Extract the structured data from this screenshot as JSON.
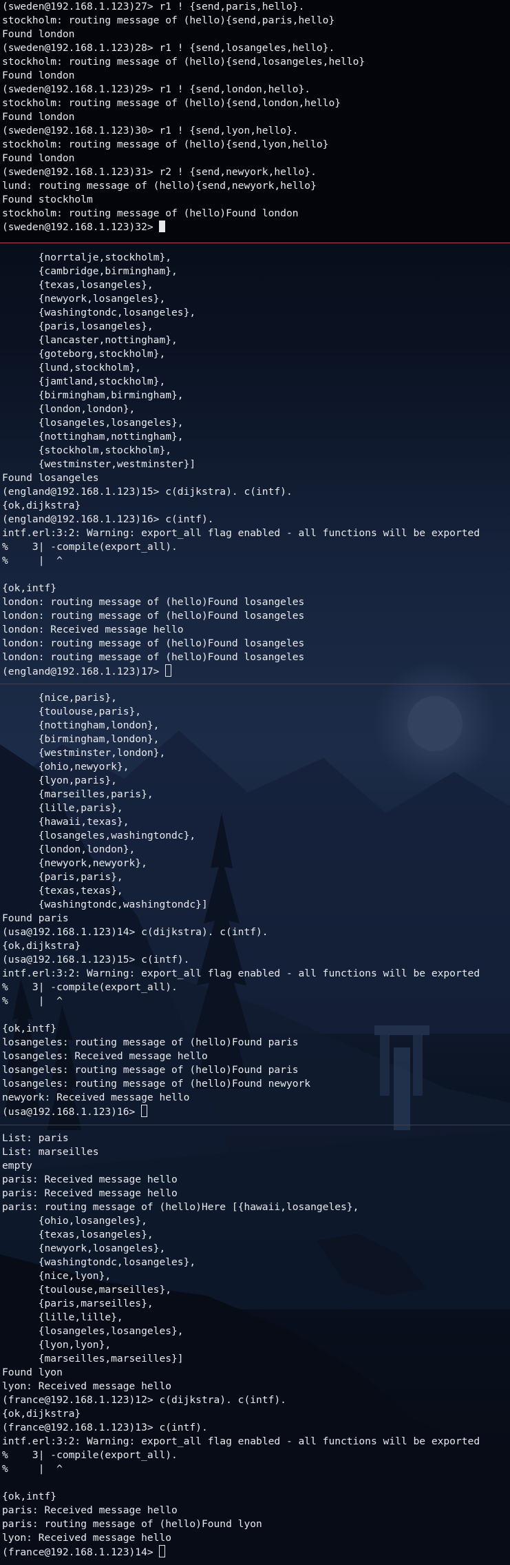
{
  "colors": {
    "background": "#0b1424",
    "text": "#e8eaee",
    "active_divider": "#b23a48",
    "inactive_divider": "#3b4253"
  },
  "panes": [
    {
      "node": "sweden",
      "lines": [
        "(sweden@192.168.1.123)27> r1 ! {send,paris,hello}.",
        "stockholm: routing message of (hello){send,paris,hello}",
        "Found london",
        "(sweden@192.168.1.123)28> r1 ! {send,losangeles,hello}.",
        "stockholm: routing message of (hello){send,losangeles,hello}",
        "Found london",
        "(sweden@192.168.1.123)29> r1 ! {send,london,hello}.",
        "stockholm: routing message of (hello){send,london,hello}",
        "Found london",
        "(sweden@192.168.1.123)30> r1 ! {send,lyon,hello}.",
        "stockholm: routing message of (hello){send,lyon,hello}",
        "Found london",
        "(sweden@192.168.1.123)31> r2 ! {send,newyork,hello}.",
        "lund: routing message of (hello){send,newyork,hello}",
        "Found stockholm",
        "stockholm: routing message of (hello)Found london"
      ],
      "prompt": "(sweden@192.168.1.123)32> "
    },
    {
      "node": "england",
      "lines": [
        "      {norrtalje,stockholm},",
        "      {cambridge,birmingham},",
        "      {texas,losangeles},",
        "      {newyork,losangeles},",
        "      {washingtondc,losangeles},",
        "      {paris,losangeles},",
        "      {lancaster,nottingham},",
        "      {goteborg,stockholm},",
        "      {lund,stockholm},",
        "      {jamtland,stockholm},",
        "      {birmingham,birmingham},",
        "      {london,london},",
        "      {losangeles,losangeles},",
        "      {nottingham,nottingham},",
        "      {stockholm,stockholm},",
        "      {westminster,westminster}]",
        "Found losangeles",
        "(england@192.168.1.123)15> c(dijkstra). c(intf).",
        "{ok,dijkstra}",
        "(england@192.168.1.123)16> c(intf).",
        "intf.erl:3:2: Warning: export_all flag enabled - all functions will be exported",
        "%    3| -compile(export_all).",
        "%     |  ^",
        "",
        "{ok,intf}",
        "london: routing message of (hello)Found losangeles",
        "london: routing message of (hello)Found losangeles",
        "london: Received message hello",
        "london: routing message of (hello)Found losangeles",
        "london: routing message of (hello)Found losangeles"
      ],
      "prompt": "(england@192.168.1.123)17> "
    },
    {
      "node": "usa",
      "lines": [
        "      {nice,paris},",
        "      {toulouse,paris},",
        "      {nottingham,london},",
        "      {birmingham,london},",
        "      {westminster,london},",
        "      {ohio,newyork},",
        "      {lyon,paris},",
        "      {marseilles,paris},",
        "      {lille,paris},",
        "      {hawaii,texas},",
        "      {losangeles,washingtondc},",
        "      {london,london},",
        "      {newyork,newyork},",
        "      {paris,paris},",
        "      {texas,texas},",
        "      {washingtondc,washingtondc}]",
        "Found paris",
        "(usa@192.168.1.123)14> c(dijkstra). c(intf).",
        "{ok,dijkstra}",
        "(usa@192.168.1.123)15> c(intf).",
        "intf.erl:3:2: Warning: export_all flag enabled - all functions will be exported",
        "%    3| -compile(export_all).",
        "%     |  ^",
        "",
        "{ok,intf}",
        "losangeles: routing message of (hello)Found paris",
        "losangeles: Received message hello",
        "losangeles: routing message of (hello)Found paris",
        "losangeles: routing message of (hello)Found newyork",
        "newyork: Received message hello"
      ],
      "prompt": "(usa@192.168.1.123)16> "
    },
    {
      "node": "france",
      "lines": [
        "List: paris",
        "List: marseilles",
        "empty",
        "paris: Received message hello",
        "paris: Received message hello",
        "paris: routing message of (hello)Here [{hawaii,losangeles},",
        "      {ohio,losangeles},",
        "      {texas,losangeles},",
        "      {newyork,losangeles},",
        "      {washingtondc,losangeles},",
        "      {nice,lyon},",
        "      {toulouse,marseilles},",
        "      {paris,marseilles},",
        "      {lille,lille},",
        "      {losangeles,losangeles},",
        "      {lyon,lyon},",
        "      {marseilles,marseilles}]",
        "Found lyon",
        "lyon: Received message hello",
        "(france@192.168.1.123)12> c(dijkstra). c(intf).",
        "{ok,dijkstra}",
        "(france@192.168.1.123)13> c(intf).",
        "intf.erl:3:2: Warning: export_all flag enabled - all functions will be exported",
        "%    3| -compile(export_all).",
        "%     |  ^",
        "",
        "{ok,intf}",
        "paris: Received message hello",
        "paris: routing message of (hello)Found lyon",
        "lyon: Received message hello"
      ],
      "prompt": "(france@192.168.1.123)14> "
    }
  ]
}
